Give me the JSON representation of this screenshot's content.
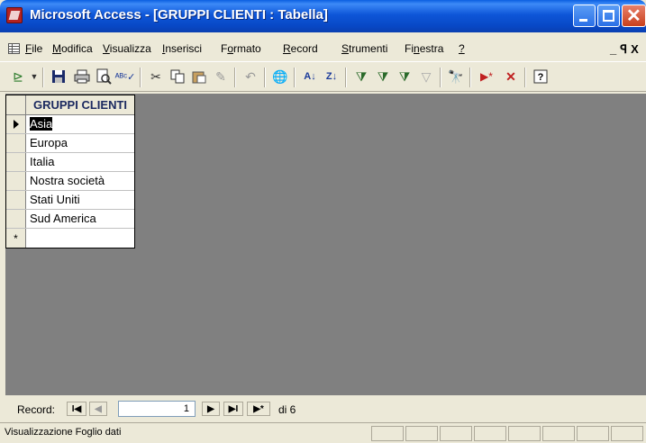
{
  "window": {
    "title": "Microsoft Access - [GRUPPI CLIENTI : Tabella]"
  },
  "menu": {
    "items": [
      {
        "label": "File",
        "ul": "F",
        "rest": "ile"
      },
      {
        "label": "Modifica",
        "ul": "M",
        "rest": "odifica"
      },
      {
        "label": "Visualizza",
        "ul": "V",
        "rest": "isualizza"
      },
      {
        "label": "Inserisci",
        "ul": "I",
        "rest": "nserisci"
      },
      {
        "label": "Formato",
        "pre": "F",
        "ul": "o",
        "rest": "rmato"
      },
      {
        "label": "Record",
        "ul": "R",
        "rest": "ecord"
      },
      {
        "label": "Strumenti",
        "ul": "S",
        "rest": "trumenti"
      },
      {
        "label": "Finestra",
        "pre": "Fi",
        "ul": "n",
        "rest": "estra"
      },
      {
        "label": "?",
        "ul": "?",
        "rest": ""
      }
    ],
    "mdi_minimize": "_",
    "mdi_restore": "ʇ",
    "mdi_close": "X"
  },
  "table": {
    "column_header": "GRUPPI CLIENTI",
    "rows": [
      "Asia",
      "Europa",
      "Italia",
      "Nostra società",
      "Stati Uniti",
      "Sud America"
    ],
    "new_row_marker": "*"
  },
  "navigation": {
    "label": "Record:",
    "current": "1",
    "count_text": "di 6",
    "btn_first": "I◀",
    "btn_prev": "◀",
    "btn_next": "▶",
    "btn_last": "▶I",
    "btn_new": "▶*"
  },
  "status": {
    "text": "Visualizzazione Foglio dati"
  },
  "toolbar": {
    "icons": [
      "view-icon",
      "dropdown-arrow-icon",
      "save-icon",
      "print-icon",
      "print-preview-icon",
      "spelling-icon",
      "cut-icon",
      "copy-icon",
      "paste-icon",
      "format-painter-icon",
      "undo-icon",
      "hyperlink-icon",
      "sort-ascending-icon",
      "sort-descending-icon",
      "filter-by-selection-icon",
      "filter-by-form-icon",
      "apply-filter-icon",
      "remove-filter-icon",
      "find-icon",
      "new-record-icon",
      "delete-record-icon",
      "help-icon"
    ]
  },
  "colors": {
    "title_bar": "#0a4fd0",
    "workspace": "#808080",
    "chrome": "#ece9d8",
    "close_button": "#c8401c"
  }
}
